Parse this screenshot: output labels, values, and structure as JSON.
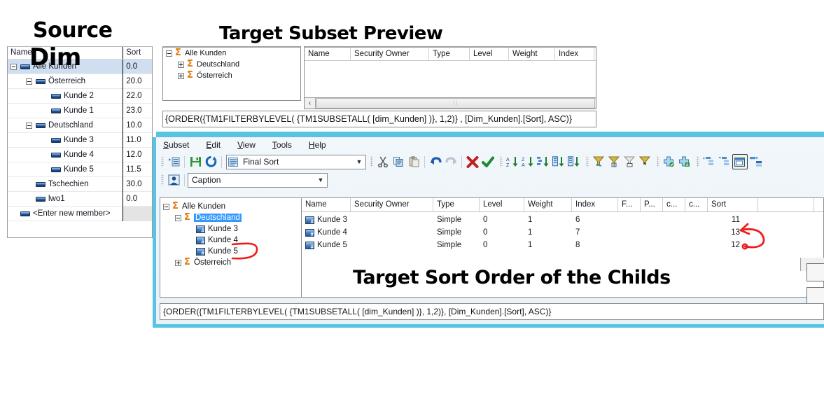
{
  "annotations": {
    "source_title": "Source",
    "source_subtitle": "Dim",
    "preview_title": "Target Subset Preview",
    "sort_order_note": "Target Sort Order of the Childs"
  },
  "source_dim": {
    "columns": [
      "Name",
      "Sort"
    ],
    "rows": [
      {
        "label": "Alle Kunden",
        "sort": "0.0",
        "indent": 0,
        "toggle": "minus",
        "selected": true
      },
      {
        "label": "Österreich",
        "sort": "20.0",
        "indent": 1,
        "toggle": "minus",
        "selected": false
      },
      {
        "label": "Kunde 2",
        "sort": "22.0",
        "indent": 2,
        "toggle": "none",
        "selected": false
      },
      {
        "label": "Kunde 1",
        "sort": "23.0",
        "indent": 2,
        "toggle": "none",
        "selected": false
      },
      {
        "label": "Deutschland",
        "sort": "10.0",
        "indent": 1,
        "toggle": "minus",
        "selected": false
      },
      {
        "label": "Kunde 3",
        "sort": "11.0",
        "indent": 2,
        "toggle": "none",
        "selected": false
      },
      {
        "label": "Kunde 4",
        "sort": "12.0",
        "indent": 2,
        "toggle": "none",
        "selected": false
      },
      {
        "label": "Kunde 5",
        "sort": "11.5",
        "indent": 2,
        "toggle": "none",
        "selected": false
      },
      {
        "label": "Tschechien",
        "sort": "30.0",
        "indent": 1,
        "toggle": "none",
        "selected": false
      },
      {
        "label": "lwo1",
        "sort": "0.0",
        "indent": 1,
        "toggle": "none",
        "selected": false
      },
      {
        "label": "<Enter new member>",
        "sort": "",
        "indent": 0,
        "toggle": "none",
        "selected": false
      }
    ]
  },
  "preview": {
    "tree": [
      {
        "label": "Alle Kunden",
        "indent": 0,
        "toggle": "minus",
        "icon": "sigma-icon"
      },
      {
        "label": "Deutschland",
        "indent": 1,
        "toggle": "plus",
        "icon": "sigma-icon"
      },
      {
        "label": "Österreich",
        "indent": 1,
        "toggle": "plus",
        "icon": "sigma-icon"
      }
    ],
    "grid_columns": [
      "Name",
      "Security Owner",
      "Type",
      "Level",
      "Weight",
      "Index"
    ],
    "grid_rows": [],
    "scroll_left_label": "‹",
    "mdx": "{ORDER({TM1FILTERBYLEVEL( {TM1SUBSETALL( [dim_Kunden] )}, 1,2)} , [Dim_Kunden].[Sort], ASC)}"
  },
  "editor": {
    "menu": [
      {
        "label": "Subset",
        "accel": "S"
      },
      {
        "label": "Edit",
        "accel": "E"
      },
      {
        "label": "View",
        "accel": "V"
      },
      {
        "label": "Tools",
        "accel": "T"
      },
      {
        "label": "Help",
        "accel": "H"
      }
    ],
    "toolbar_row1": {
      "subset_list_icon": "subset-list-icon",
      "save_icon": "save-icon",
      "refresh_icon": "refresh-icon",
      "subset_combo_value": "Final Sort",
      "cut_icon": "cut-icon",
      "copy_icon": "copy-icon",
      "paste_icon": "paste-icon",
      "undo_icon": "undo-icon",
      "redo_icon": "redo-icon",
      "delete_icon": "delete-red-x-icon",
      "confirm_icon": "confirm-green-check-icon",
      "sort_az_icon": "sort-ascending-az-icon",
      "sort_za_icon": "sort-descending-za-icon",
      "sort_hierarchy_icon": "sort-hierarchy-icon",
      "sort_index_asc_icon": "sort-by-index-ascending-icon",
      "sort_index_desc_icon": "sort-by-index-descending-icon",
      "filter_by_level_icon": "filter-by-level-icon",
      "filter_by_attribute_icon": "filter-by-attribute-icon",
      "filter_by_expression_icon": "filter-by-expression-icon",
      "filter_by_wildcard_icon": "filter-by-wildcard-icon",
      "insert_child_icon": "insert-child-icon",
      "insert_member_icon": "insert-member-icon",
      "expand_icon": "expand-node-icon",
      "collapse_icon": "collapse-node-icon",
      "toggle_mdx_icon": "toggle-mdx-view-icon",
      "keep_icon": "keep-members-icon"
    },
    "toolbar_row2": {
      "alias_icon": "alias-user-icon",
      "alias_combo_value": "Caption"
    },
    "tree": [
      {
        "label": "Alle Kunden",
        "indent": 0,
        "toggle": "minus",
        "icon": "sigma-icon",
        "selected": false
      },
      {
        "label": "Deutschland",
        "indent": 1,
        "toggle": "minus",
        "icon": "sigma-icon",
        "selected": true
      },
      {
        "label": "Kunde 3",
        "indent": 2,
        "toggle": "none",
        "icon": "member-icon",
        "selected": false
      },
      {
        "label": "Kunde 4",
        "indent": 2,
        "toggle": "none",
        "icon": "member-icon",
        "selected": false
      },
      {
        "label": "Kunde 5",
        "indent": 2,
        "toggle": "none",
        "icon": "member-icon",
        "selected": false
      },
      {
        "label": "Österreich",
        "indent": 1,
        "toggle": "plus",
        "icon": "sigma-icon",
        "selected": false
      }
    ],
    "grid_columns": [
      "Name",
      "Security Owner",
      "Type",
      "Level",
      "Weight",
      "Index",
      "F...",
      "P...",
      "c...",
      "c...",
      "Sort",
      ""
    ],
    "grid_rows": [
      {
        "name": "Kunde 3",
        "security_owner": "",
        "type": "Simple",
        "level": "0",
        "weight": "1",
        "index": "6",
        "f": "",
        "p": "",
        "c1": "",
        "c2": "",
        "sort": "11"
      },
      {
        "name": "Kunde 4",
        "security_owner": "",
        "type": "Simple",
        "level": "0",
        "weight": "1",
        "index": "7",
        "f": "",
        "p": "",
        "c1": "",
        "c2": "",
        "sort": "13"
      },
      {
        "name": "Kunde 5",
        "security_owner": "",
        "type": "Simple",
        "level": "0",
        "weight": "1",
        "index": "8",
        "f": "",
        "p": "",
        "c1": "",
        "c2": "",
        "sort": "12"
      }
    ],
    "mdx": "{ORDER({TM1FILTERBYLEVEL( {TM1SUBSETALL( [dim_Kunden] )}, 1,2)}, [Dim_Kunden].[Sort], ASC)}"
  },
  "colors": {
    "window_border": "#59c3e3",
    "annotation_red": "#ee1c1c",
    "selection_blue": "#3399ff",
    "sigma_orange": "#e07a12",
    "source_row_selected": "#cfdff1"
  }
}
